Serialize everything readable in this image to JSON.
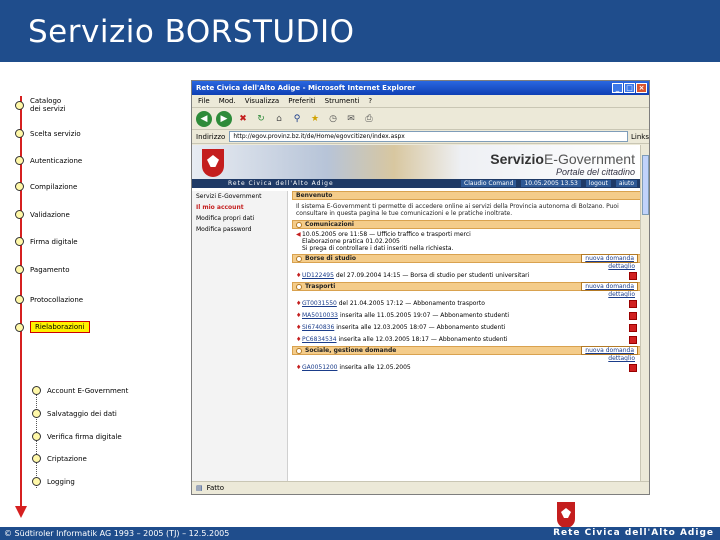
{
  "slide": {
    "title": "Servizio BORSTUDIO",
    "footer": "© Südtiroler Informatik AG 1993 – 2005 (TJ) – 12.5.2005",
    "footer_site": "Rete Civica dell'Alto Adige"
  },
  "flow": {
    "steps": [
      "Catalogo dei servizi",
      "Scelta servizio",
      "Autenticazione",
      "Compilazione",
      "Validazione",
      "Firma digitale",
      "Pagamento",
      "Protocollazione",
      "Rielaborazioni"
    ],
    "active_step": "Rielaborazioni",
    "substeps": [
      "Account E-Government",
      "Salvataggio dei dati",
      "Verifica firma digitale",
      "Criptazione",
      "Logging"
    ]
  },
  "browser": {
    "title": "Rete Civica dell'Alto Adige - Microsoft Internet Explorer",
    "menu": [
      "File",
      "Mod.",
      "Visualizza",
      "Preferiti",
      "Strumenti",
      "?"
    ],
    "address_label": "Indirizzo",
    "address": "http://egov.provinz.bz.it/de/Home/egovcitizen/index.aspx",
    "links_label": "Links",
    "status_text": "Fatto"
  },
  "portal": {
    "brand_main": "Servizio",
    "brand_rest": "E-Government",
    "subtitle": "Portale del cittadino",
    "site_name": "Rete Civica dell'Alto Adige",
    "user_name": "Claudio Comand",
    "user_date": "10.05.2005 13.53",
    "user_actions": [
      "logout",
      "aiuto"
    ],
    "nav": [
      {
        "label": "Servizi E-Government",
        "highlight": false
      },
      {
        "label": "Il mio account",
        "highlight": true
      },
      {
        "label": "Modifica propri dati",
        "highlight": false
      },
      {
        "label": "Modifica password",
        "highlight": false
      }
    ],
    "welcome_title": "Benvenuto",
    "welcome_text": "Il sistema E-Government ti permette di accedere online ai servizi della Provincia autonoma di Bolzano. Puoi consultare in questa pagina le tue comunicazioni e le pratiche inoltrate.",
    "comm_title": "Comunicazioni",
    "comm_entries": [
      "10.05.2005 ore 11:58 — Ufficio traffico e trasporti merci",
      "Elaborazione pratica 01.02.2005",
      "Si prega di controllare i dati inseriti nella richiesta."
    ],
    "borse_title": "Borse di studio",
    "borse_link": "nuova domanda",
    "borse_entries": [
      {
        "code": "UD122495",
        "text": "del 27.09.2004 14:15 — Borsa di studio per studenti universitari",
        "pdf": true
      }
    ],
    "trasporti_title": "Trasporti",
    "trasporti_link": "nuova domanda",
    "trasporti_entries": [
      {
        "code": "GT0031550",
        "text": "del 21.04.2005 17:12 — Abbonamento trasporto",
        "pdf": true
      },
      {
        "code": "MA5010033",
        "text": "inserita alle 11.05.2005 19:07 — Abbonamento studenti",
        "pdf": true
      },
      {
        "code": "SI6740836",
        "text": "inserita alle 12.03.2005 18:07 — Abbonamento studenti",
        "pdf": true
      },
      {
        "code": "PC6834534",
        "text": "inserita alle 12.03.2005 18:17 — Abbonamento studenti",
        "pdf": true
      }
    ],
    "sociale_title": "Sociale, gestione domande",
    "sociale_link": "nuova domanda",
    "sociale_entries": [
      {
        "code": "GA0051200",
        "text": "inserita alle 12.05.2005",
        "pdf": true
      }
    ],
    "detail_label": "dettaglio"
  },
  "colors": {
    "slide_blue": "#1f4d8c",
    "flow_red": "#d62020",
    "accent_yellow": "#fff200",
    "portal_orange": "#f4cc8a"
  }
}
